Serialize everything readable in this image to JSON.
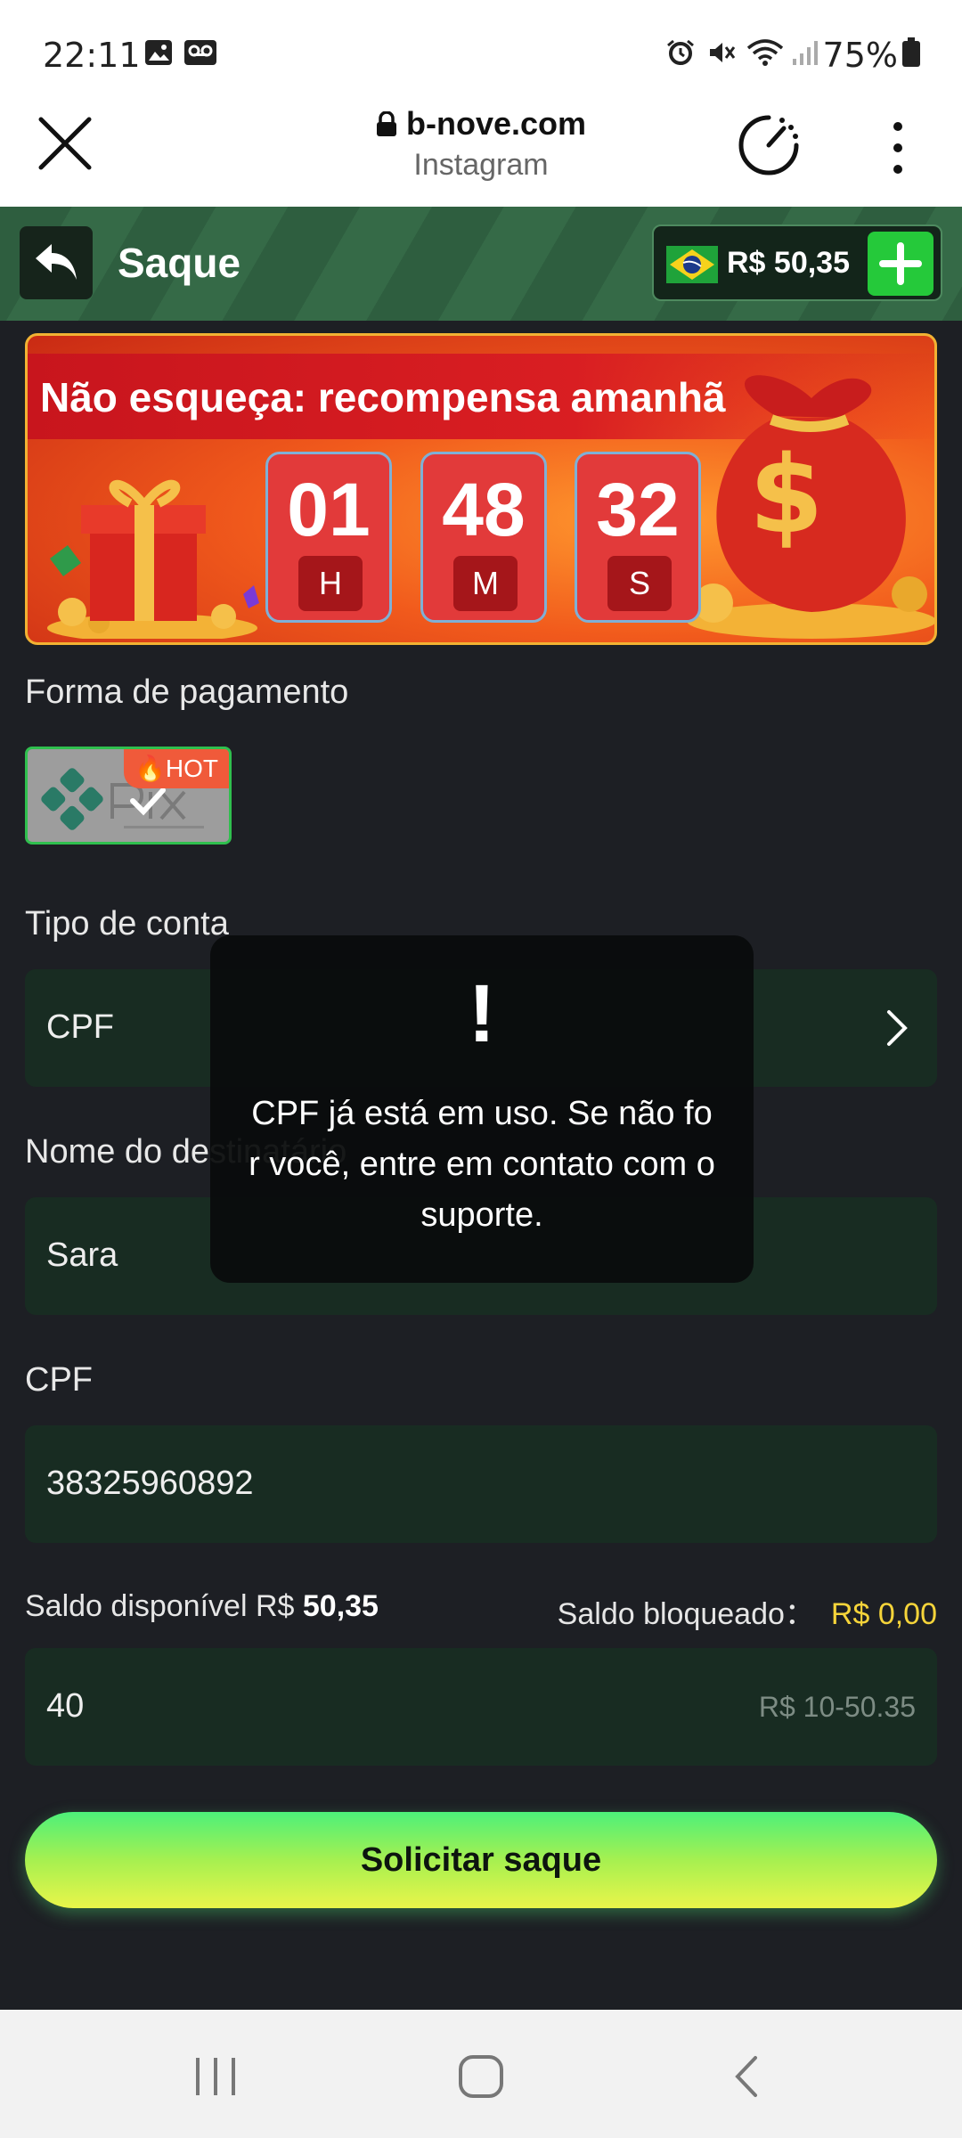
{
  "status_bar": {
    "time": "22:11",
    "battery": "75%",
    "icons": [
      "image-icon",
      "voicemail-icon",
      "alarm-icon",
      "mute-icon",
      "wifi-icon",
      "signal-icon",
      "battery-icon"
    ]
  },
  "browser": {
    "url": "b-nove.com",
    "source": "Instagram"
  },
  "header": {
    "title": "Saque",
    "balance": "R$ 50,35"
  },
  "banner": {
    "headline": "Não esqueça: recompensa amanhã",
    "countdown": {
      "hours": "01",
      "hours_label": "H",
      "minutes": "48",
      "minutes_label": "M",
      "seconds": "32",
      "seconds_label": "S"
    }
  },
  "form": {
    "payment_label": "Forma de pagamento",
    "pix_badge": "HOT",
    "account_type_label": "Tipo de conta",
    "account_type_value": "CPF",
    "recipient_label": "Nome do destinatário",
    "recipient_value": "Sara",
    "cpf_label": "CPF",
    "cpf_value": "38325960892",
    "available_label": "Saldo disponível R$",
    "available_value": "50,35",
    "blocked_label": "Saldo bloqueado：",
    "blocked_value": "R$ 0,00",
    "amount_value": "40",
    "amount_range": "R$ 10-50.35",
    "submit_label": "Solicitar saque"
  },
  "toast": {
    "symbol": "!",
    "message": "CPF já está em uso. Se não for você, entre em contato com o suporte."
  },
  "colors": {
    "accent_green": "#25c93a",
    "field_bg": "#182c22",
    "yellow": "#f5d43a"
  }
}
